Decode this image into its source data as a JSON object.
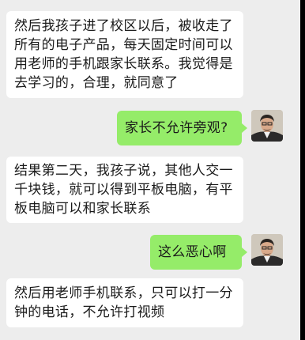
{
  "messages": [
    {
      "side": "in",
      "lines": [
        "然后我孩子进了校区以后，被收走了",
        "所有的电子产品，每天固定时间可以",
        "用老师的手机跟家长联系。我觉得是",
        "去学习的，合理，就同意了"
      ]
    },
    {
      "side": "out",
      "lines": [
        "家长不允许旁观?"
      ]
    },
    {
      "side": "in",
      "lines": [
        "结果第二天，我孩子说，其他人交一",
        "千块钱，就可以得到平板电脑，有平",
        "板电脑可以和家长联系"
      ]
    },
    {
      "side": "out",
      "lines": [
        "这么恶心啊"
      ]
    },
    {
      "side": "in",
      "lines": [
        "然后用老师手机联系，只可以打一分",
        "钟的电话，不允许打视频"
      ]
    }
  ],
  "colors": {
    "background": "#ededed",
    "incoming_bubble": "#ffffff",
    "outgoing_bubble": "#95ec69"
  }
}
